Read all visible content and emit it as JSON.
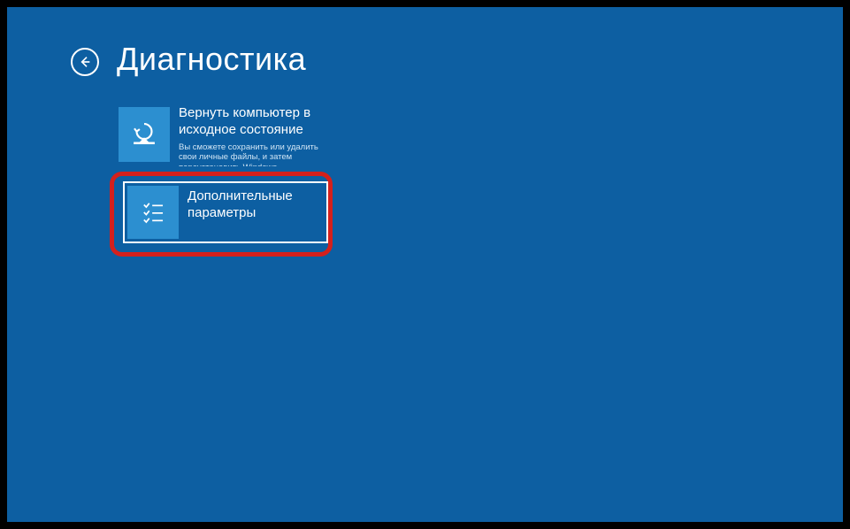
{
  "header": {
    "title": "Диагностика"
  },
  "options": {
    "reset": {
      "title": "Вернуть компьютер в исходное состояние",
      "description": "Вы сможете сохранить или удалить свои личные файлы, и затем переустановить Windows"
    },
    "advanced": {
      "title": "Дополнительные параметры"
    }
  }
}
